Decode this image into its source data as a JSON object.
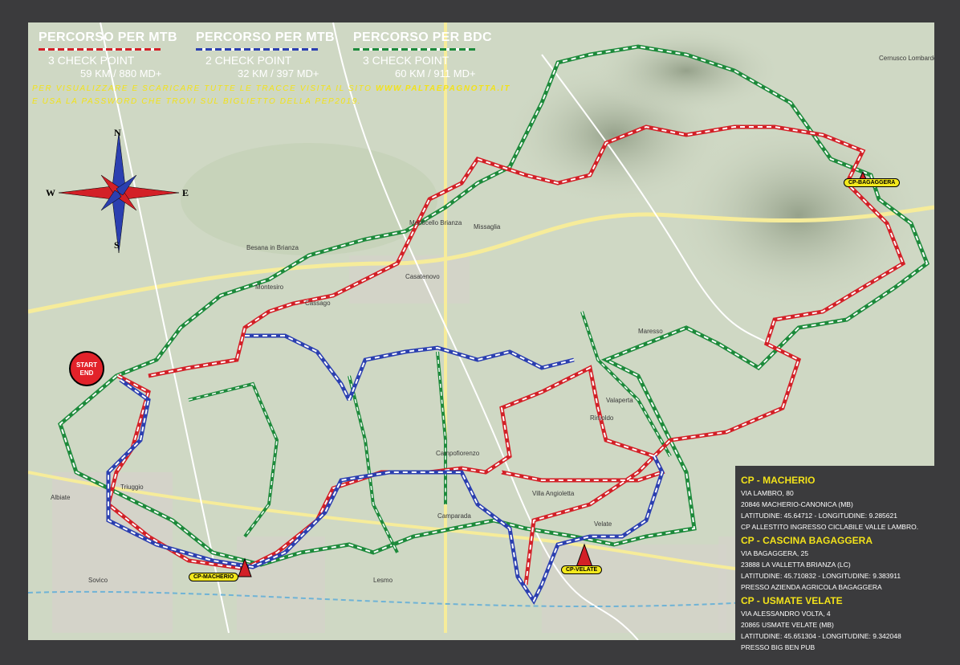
{
  "legend": [
    {
      "title": "PERCORSO PER MTB",
      "checkpoints": "3 CHECK POINT",
      "stats": "59 KM / 880 MD+",
      "colors": [
        "#d32027",
        "#ffffff"
      ]
    },
    {
      "title": "PERCORSO PER MTB",
      "checkpoints": "2 CHECK POINT",
      "stats": "32 KM / 397 MD+",
      "colors": [
        "#2b3fb0",
        "#ffffff"
      ]
    },
    {
      "title": "PERCORSO PER BDC",
      "checkpoints": "3 CHECK POINT",
      "stats": "60 KM / 911 MD+",
      "colors": [
        "#1d8a3b",
        "#ffffff"
      ]
    }
  ],
  "notice": {
    "line1_prefix": "PER VISUALIZZARE E SCARICARE TUTTE LE TRACCE VISITA IL SITO ",
    "site": "WWW.PALTAEPAGNOTTA.IT",
    "line2": "E USA LA PASSWORD CHE TROVI SUL BIGLIETTO DELLA PEP2019."
  },
  "checkpoints": [
    {
      "title": "CP - MACHERIO",
      "lines": [
        "VIA LAMBRO, 80",
        "20846 MACHERIO-CANONICA (MB)",
        "LATITUDINE: 45.64712 - LONGITUDINE: 9.285621",
        "CP ALLESTITO INGRESSO CICLABILE VALLE LAMBRO."
      ]
    },
    {
      "title": "CP - CASCINA BAGAGGERA",
      "lines": [
        "VIA BAGAGGERA, 25",
        "23888 LA VALLETTA BRIANZA (LC)",
        "LATITUDINE: 45.710832 - LONGITUDINE: 9.383911",
        "PRESSO AZIENDA AGRICOLA BAGAGGERA"
      ]
    },
    {
      "title": "CP - USMATE VELATE",
      "lines": [
        "VIA ALESSANDRO VOLTA, 4",
        "20865 USMATE VELATE (MB)",
        "LATITUDINE: 45.651304 - LONGITUDINE: 9.342048",
        "PRESSO BIG BEN PUB"
      ]
    }
  ],
  "map_tags": {
    "macherio": "CP-MACHERIO",
    "bagaggera": "CP-BAGAGGERA",
    "velate": "CP-VELATE"
  },
  "start_end": {
    "line1": "START",
    "line2": "END"
  },
  "compass": {
    "n": "N",
    "s": "S",
    "e": "E",
    "w": "W"
  },
  "place_labels": [
    {
      "name": "Casatenovo"
    },
    {
      "name": "Besana in Brianza"
    },
    {
      "name": "Lesmo"
    },
    {
      "name": "Valaperta"
    },
    {
      "name": "Rimoldo"
    },
    {
      "name": "Villa Angioletta"
    },
    {
      "name": "Campofiorenzo"
    },
    {
      "name": "Montesiro"
    },
    {
      "name": "Triuggio"
    },
    {
      "name": "Albiate"
    },
    {
      "name": "Sovico"
    },
    {
      "name": "Monticello Brianza"
    },
    {
      "name": "Missaglia"
    },
    {
      "name": "Cernusco Lombardone"
    },
    {
      "name": "Maresso"
    },
    {
      "name": "Velate"
    },
    {
      "name": "Cassago"
    },
    {
      "name": "Camparada"
    }
  ],
  "colors": {
    "map_bg": "#cfd8c4",
    "frame": "#3b3b3d",
    "accent": "#f2e21a",
    "red": "#d32027",
    "blue": "#2b3fb0",
    "green": "#1d8a3b"
  }
}
